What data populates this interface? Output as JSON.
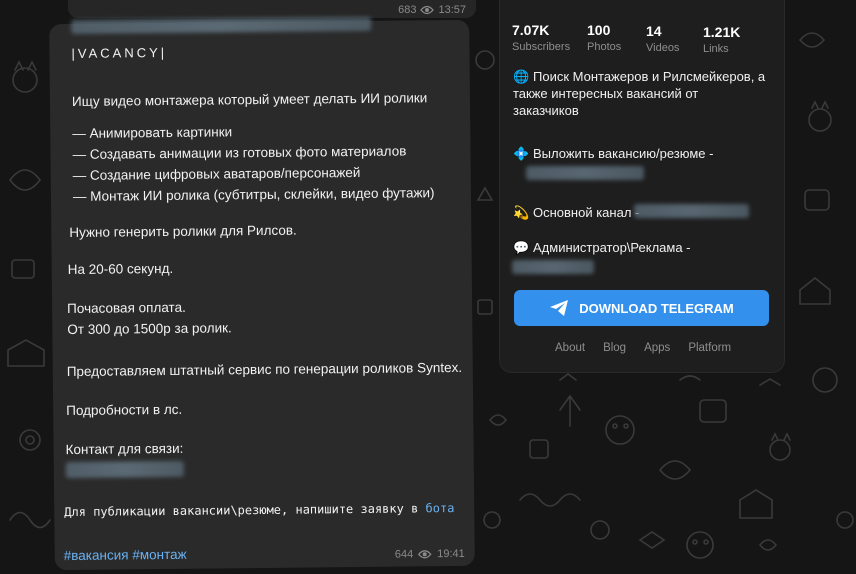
{
  "previous_message": {
    "views": "683",
    "time": "13:57"
  },
  "message": {
    "tag": "|VACANCY|",
    "intro": "Ищу видео монтажера который умеет делать ИИ ролики",
    "tasks": [
      "— Анимировать картинки",
      "— Создавать анимации из готовых фото материалов",
      "— Создание цифровых аватаров/персонажей",
      "— Монтаж ИИ ролика (субтитры, склейки, видео футажи)"
    ],
    "line_reels": "Нужно генерить ролики для Рилсов.",
    "line_duration": "На 20-60 секунд.",
    "line_pay_1": "Почасовая оплата.",
    "line_pay_2": "От 300 до 1500р за ролик.",
    "line_service": "Предоставляем штатный сервис по генерации роликов Syntex.",
    "line_details": "Подробности в лс.",
    "contact_label": "Контакт для связи:",
    "publish_text": "Для публикации вакансии\\резюме, напишите заявку в",
    "publish_link": "бота",
    "hashtag_1": "#вакансия",
    "hashtag_2": "#монтаж",
    "views": "644",
    "time": "19:41"
  },
  "channel": {
    "stats": [
      {
        "value": "7.07K",
        "label": "Subscribers"
      },
      {
        "value": "100",
        "label": "Photos"
      },
      {
        "value": "14",
        "label": "Videos"
      },
      {
        "value": "1.21K",
        "label": "Links"
      }
    ],
    "desc_emoji": "🌐",
    "desc_line_1": "Поиск Монтажеров и Рилсмейкеров, а",
    "desc_line_2": "также интересных вакансий от",
    "desc_line_3": "заказчиков",
    "post_emoji": "💠",
    "post_label": "Выложить вакансию/резюме -",
    "main_emoji": "💫",
    "main_label": "Основной канал -",
    "admin_emoji": "💬",
    "admin_label": "Администратор\\Реклама -",
    "download_label": "DOWNLOAD TELEGRAM",
    "footer": [
      "About",
      "Blog",
      "Apps",
      "Platform"
    ]
  },
  "colors": {
    "accent": "#3390ec",
    "link": "#6ab2f2",
    "bubble": "#2a2a2a",
    "panel": "#1e1e1e"
  },
  "icons": {
    "views": "eye-icon",
    "download": "telegram-plane-icon"
  }
}
